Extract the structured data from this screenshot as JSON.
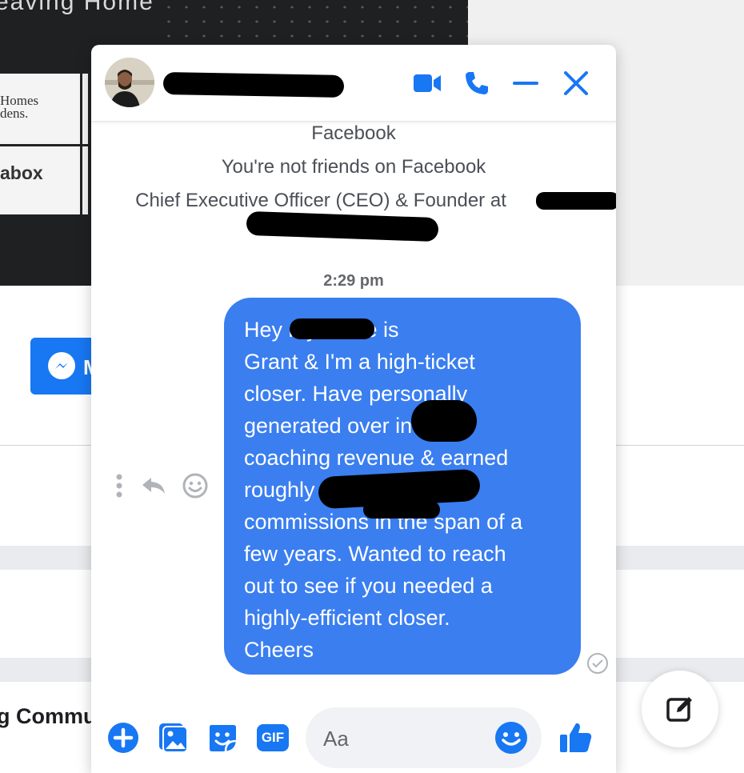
{
  "background": {
    "banner_title": "eaving Home",
    "logo_1": "Homes\ndens.",
    "logo_2": "abox",
    "messenger_button_letter": "M",
    "bottom_text": "g Commu"
  },
  "chat": {
    "header": {
      "contact_name": "",
      "icons": [
        "video-camera-icon",
        "phone-icon",
        "minimize-icon",
        "close-icon"
      ]
    },
    "profile_info": {
      "network": "Facebook",
      "relationship": "You're not friends on Facebook",
      "work": "Chief Executive Officer (CEO) & Founder at"
    },
    "timestamp": "2:29 pm",
    "message": {
      "text": "Hey                 my name is\nGrant & I'm a high-ticket\ncloser. Have personally\ngenerated over              in\ncoaching revenue & earned\nroughly\ncommissions in the span of a\nfew years. Wanted to reach\nout to see if you needed a\nhighly-efficient closer.\nCheers"
    },
    "message_actions": [
      "more-options-icon",
      "reply-icon",
      "react-icon"
    ],
    "composer": {
      "placeholder": "Aa",
      "gif_label": "GIF",
      "icons": [
        "plus-icon",
        "image-icon",
        "sticker-icon",
        "gif-icon",
        "emoji-icon",
        "thumbs-up-icon"
      ]
    }
  },
  "colors": {
    "accent": "#1877f2",
    "bubble": "#3a7ef0"
  }
}
